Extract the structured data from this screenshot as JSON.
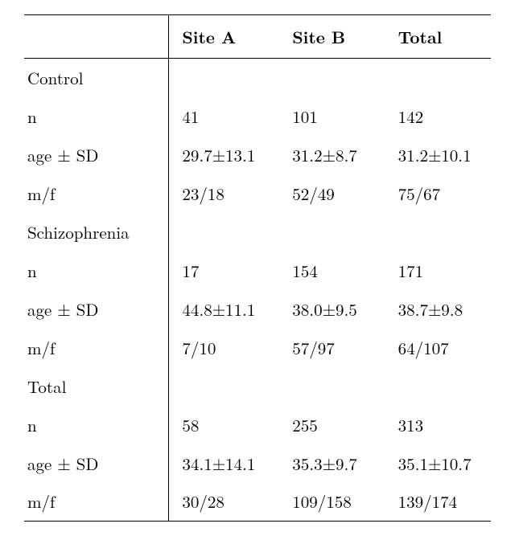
{
  "chart_data": {
    "type": "table",
    "columns": [
      "",
      "Site A",
      "Site B",
      "Total"
    ],
    "sections": [
      {
        "name": "Control",
        "rows": [
          {
            "label": "n",
            "values": [
              "41",
              "101",
              "142"
            ]
          },
          {
            "label": "age ± SD",
            "values": [
              "29.7±13.1",
              "31.2±8.7",
              "31.2±10.1"
            ]
          },
          {
            "label": "m/f",
            "values": [
              "23/18",
              "52/49",
              "75/67"
            ]
          }
        ]
      },
      {
        "name": "Schizophrenia",
        "rows": [
          {
            "label": "n",
            "values": [
              "17",
              "154",
              "171"
            ]
          },
          {
            "label": "age ± SD",
            "values": [
              "44.8±11.1",
              "38.0±9.5",
              "38.7±9.8"
            ]
          },
          {
            "label": "m/f",
            "values": [
              "7/10",
              "57/97",
              "64/107"
            ]
          }
        ]
      },
      {
        "name": "Total",
        "rows": [
          {
            "label": "n",
            "values": [
              "58",
              "255",
              "313"
            ]
          },
          {
            "label": "age ± SD",
            "values": [
              "34.1±14.1",
              "35.3±9.7",
              "35.1±10.7"
            ]
          },
          {
            "label": "m/f",
            "values": [
              "30/28",
              "109/158",
              "139/174"
            ]
          }
        ]
      }
    ]
  },
  "headers": {
    "c1": "Site A",
    "c2": "Site B",
    "c3": "Total"
  },
  "sec0": {
    "name": "Control",
    "r0": {
      "label": "n",
      "a": "41",
      "b": "101",
      "t": "142"
    },
    "r1": {
      "label": "age ± SD",
      "a": "29.7±13.1",
      "b": "31.2±8.7",
      "t": "31.2±10.1"
    },
    "r2": {
      "label": "m/f",
      "a": "23/18",
      "b": "52/49",
      "t": "75/67"
    }
  },
  "sec1": {
    "name": "Schizophrenia",
    "r0": {
      "label": "n",
      "a": "17",
      "b": "154",
      "t": "171"
    },
    "r1": {
      "label": "age ± SD",
      "a": "44.8±11.1",
      "b": "38.0±9.5",
      "t": "38.7±9.8"
    },
    "r2": {
      "label": "m/f",
      "a": "7/10",
      "b": "57/97",
      "t": "64/107"
    }
  },
  "sec2": {
    "name": "Total",
    "r0": {
      "label": "n",
      "a": "58",
      "b": "255",
      "t": "313"
    },
    "r1": {
      "label": "age ± SD",
      "a": "34.1±14.1",
      "b": "35.3±9.7",
      "t": "35.1±10.7"
    },
    "r2": {
      "label": "m/f",
      "a": "30/28",
      "b": "109/158",
      "t": "139/174"
    }
  }
}
